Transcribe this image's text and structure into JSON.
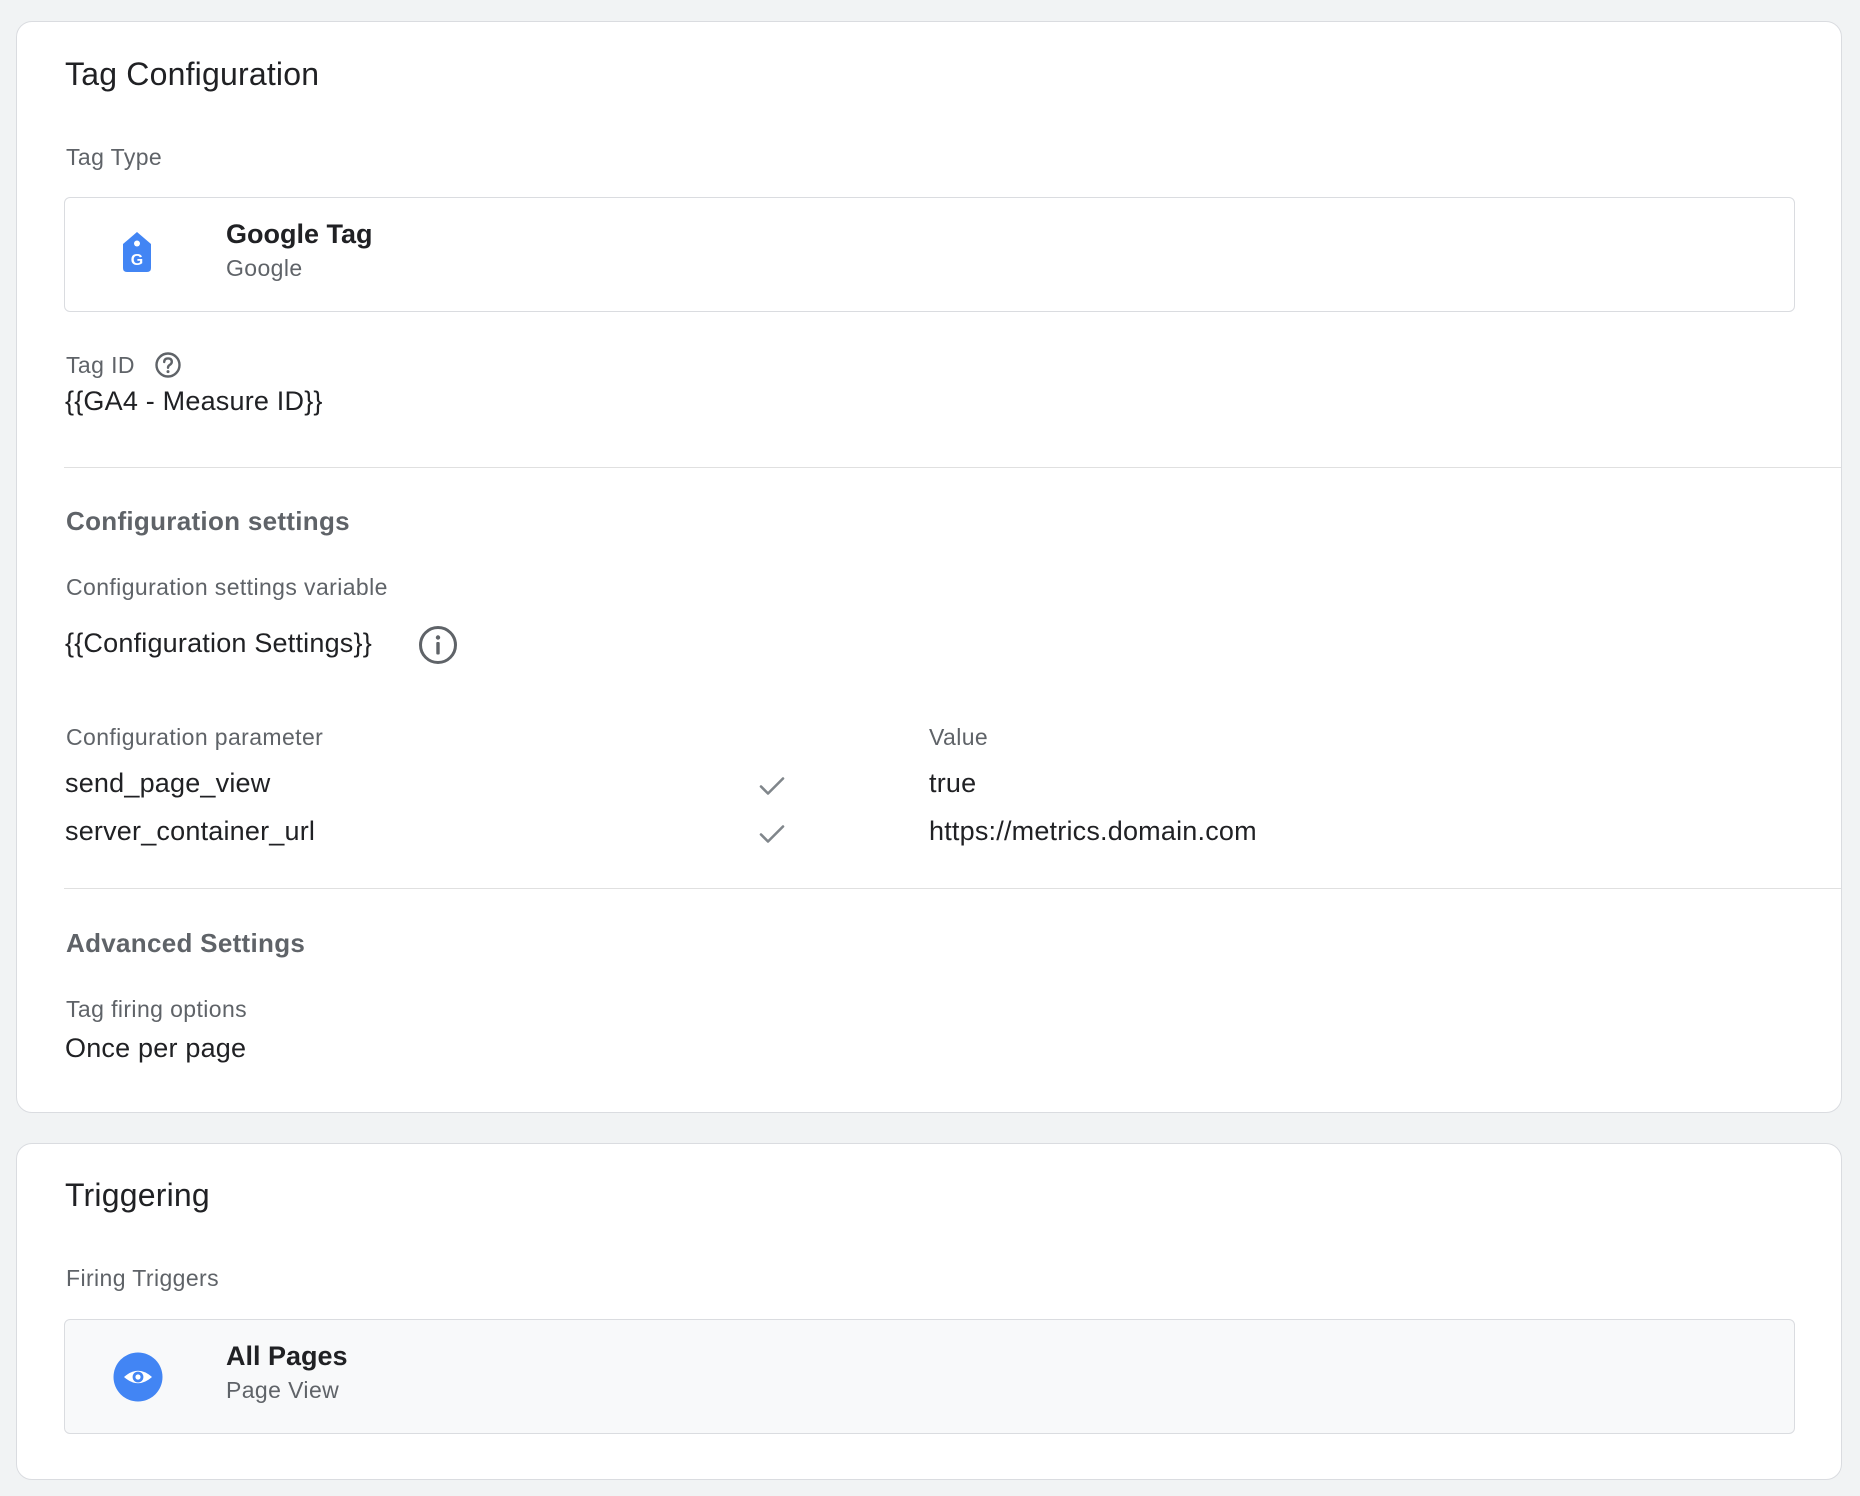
{
  "tag_configuration": {
    "title": "Tag Configuration",
    "tag_type_label": "Tag Type",
    "tag_type": {
      "name": "Google Tag",
      "vendor": "Google",
      "icon": "google-tag-icon",
      "icon_color": "#4285f4"
    },
    "tag_id_label": "Tag ID",
    "tag_id_value": "{{GA4 - Measure ID}}",
    "help_icon": "help-circle-icon"
  },
  "configuration_settings": {
    "title": "Configuration settings",
    "variable_label": "Configuration settings variable",
    "variable_value": "{{Configuration Settings}}",
    "info_icon": "info-circle-icon",
    "columns": {
      "parameter": "Configuration parameter",
      "value": "Value"
    },
    "rows": [
      {
        "parameter": "send_page_view",
        "value": "true",
        "icon": "check-icon"
      },
      {
        "parameter": "server_container_url",
        "value": "https://metrics.domain.com",
        "icon": "check-icon"
      }
    ]
  },
  "advanced_settings": {
    "title": "Advanced Settings",
    "firing_options_label": "Tag firing options",
    "firing_options_value": "Once per page"
  },
  "triggering": {
    "title": "Triggering",
    "firing_triggers_label": "Firing Triggers",
    "trigger": {
      "name": "All Pages",
      "type": "Page View",
      "icon": "eye-icon",
      "icon_color": "#4285f4"
    }
  }
}
